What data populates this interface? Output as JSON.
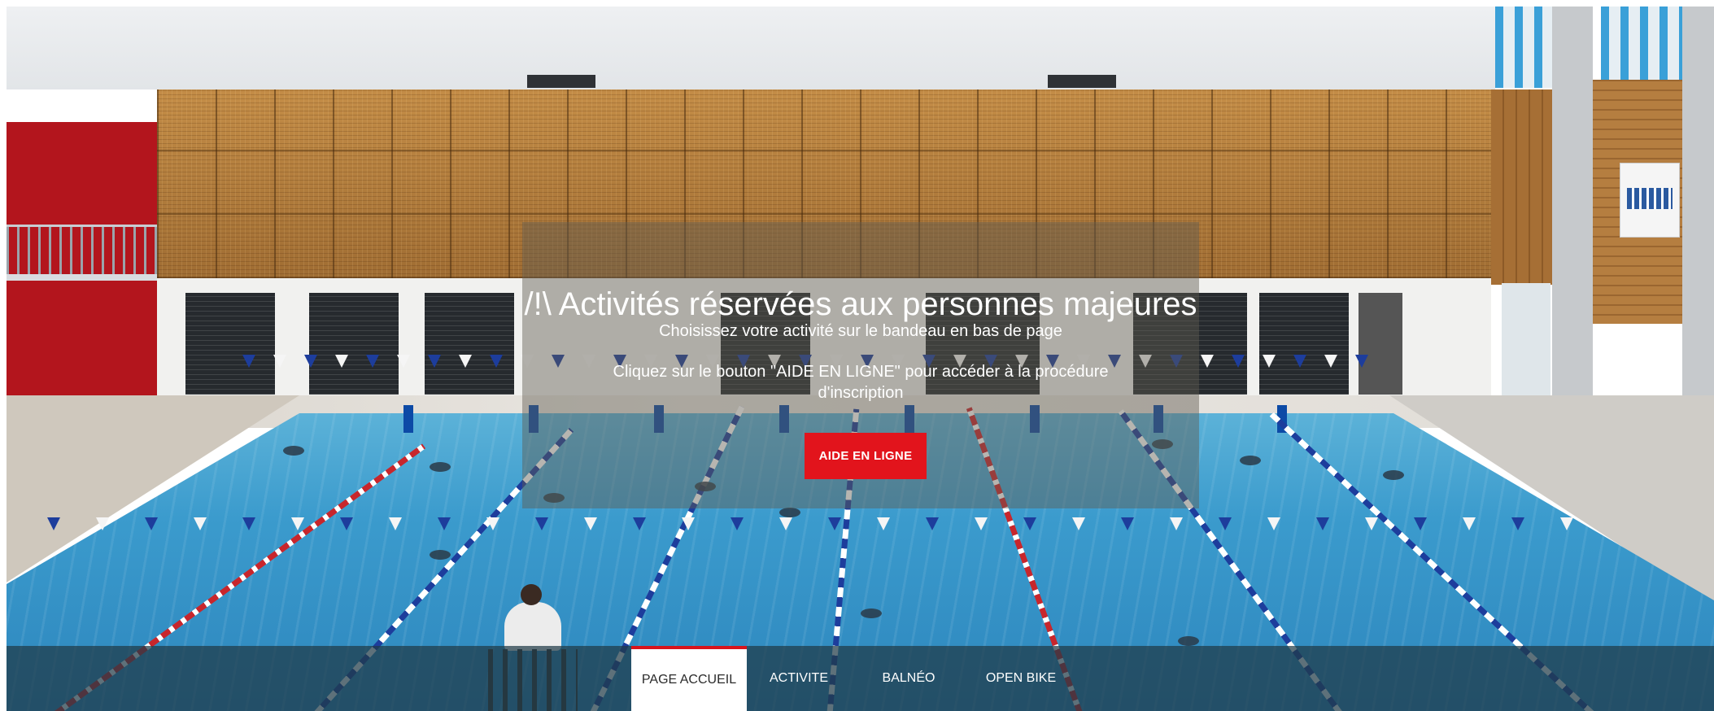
{
  "hero": {
    "headline": "/!\\ Activités réservées aux personnes majeures",
    "line1": "Choisissez votre activité sur le bandeau en bas de page",
    "line2": "Cliquez sur le bouton \"AIDE EN LIGNE\" pour accéder à la procédure d'inscription",
    "button_label": "AIDE EN LIGNE",
    "button_color": "#e2141c"
  },
  "nav": {
    "items": [
      {
        "label": "PAGE ACCUEIL",
        "active": true
      },
      {
        "label": "ACTIVITE",
        "active": false
      },
      {
        "label": "BALNÉO",
        "active": false
      },
      {
        "label": "OPEN BIKE",
        "active": false
      }
    ],
    "active_color": "#d8141c"
  }
}
